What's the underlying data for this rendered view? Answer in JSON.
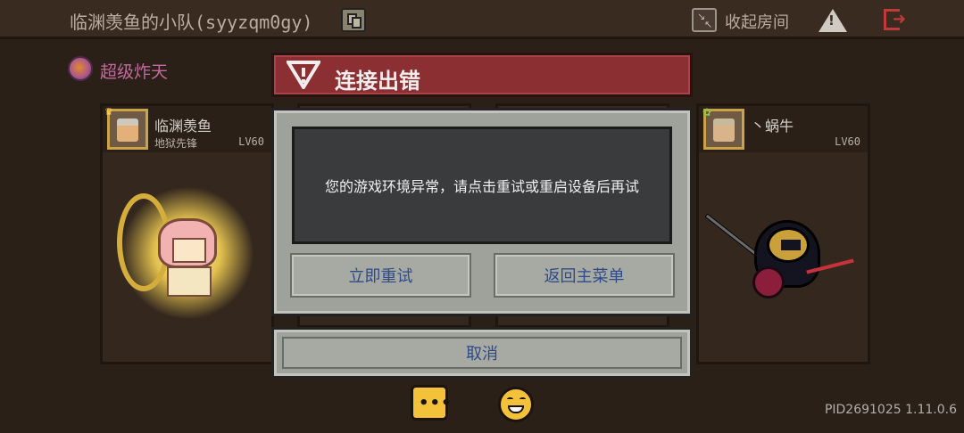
{
  "topbar": {
    "team_title": "临渊羡鱼的小队(syyzqm0gy)",
    "copy_icon": "copy-icon",
    "collapse_label": "收起房间",
    "collapse_icon": "collapse-arrows-icon",
    "warning_icon": "warning-triangle-icon",
    "exit_icon": "exit-door-icon"
  },
  "mode": {
    "label": "超级炸天",
    "icon": "mode-badge-icon"
  },
  "players": [
    {
      "name": "临渊羡鱼",
      "role": "地狱先锋",
      "level": "LV60",
      "is_leader": true
    },
    {
      "name": "丶蜗牛",
      "role": "",
      "level": "LV60",
      "is_leader": false
    }
  ],
  "dialog": {
    "title": "连接出错",
    "title_icon": "warning-shield-icon",
    "message": "您的游戏环境异常，请点击重试或重启设备后再试",
    "retry_label": "立即重试",
    "menu_label": "返回主菜单",
    "cancel_label": "取消",
    "title_bg": "#8b2f32",
    "panel_bg": "#9fa29b",
    "button_text_color": "#2e4a8a"
  },
  "bottom": {
    "chat_icon": "chat-bubble-icon",
    "emote_icon": "grin-emoji-icon",
    "version": "PID2691025 1.11.0.6"
  }
}
